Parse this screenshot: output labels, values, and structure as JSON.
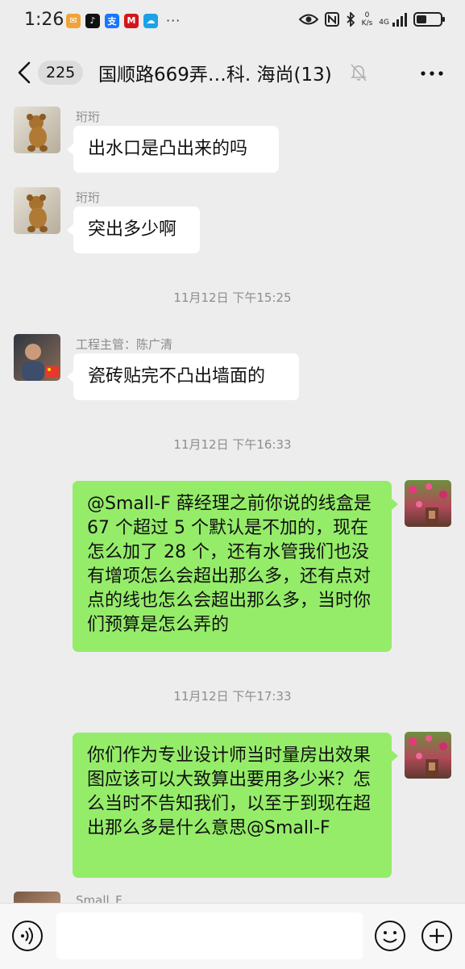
{
  "status_bar": {
    "time": "1:26",
    "speed_value": "0",
    "speed_unit": "K/s",
    "network": "4G"
  },
  "header": {
    "unread_count": "225",
    "title": "国顺路669弄…科. 海尚(13)"
  },
  "messages": [
    {
      "sender": "珩珩",
      "text": "出水口是凸出来的吗"
    },
    {
      "sender": "珩珩",
      "text": "突出多少啊"
    },
    {
      "timestamp": "11月12日 下午15:25"
    },
    {
      "sender": "工程主管：陈广清",
      "text": "瓷砖贴完不凸出墙面的"
    },
    {
      "timestamp": "11月12日 下午16:33"
    },
    {
      "text": "@Small-F  薛经理之前你说的线盒是 67 个超过 5 个默认是不加的，现在怎么加了 28 个，还有水管我们也没有增项怎么会超出那么多，还有点对点的线也怎么会超出那么多，当时你们预算是怎么弄的"
    },
    {
      "timestamp": "11月12日 下午17:33"
    },
    {
      "text": "你们作为专业设计师当时量房出效果图应该可以大致算出要用多少米？怎么当时不告知我们，以至于到现在超出那么多是什么意思@Small-F"
    },
    {
      "sender": "Small_F"
    }
  ],
  "colors": {
    "chat_background": "#ededed",
    "incoming_bubble": "#ffffff",
    "outgoing_bubble": "#95ec69"
  },
  "icons": {
    "back": "chevron-left-icon",
    "mute": "bell-off-icon",
    "more": "more-dots-icon",
    "voice": "voice-icon",
    "emoji": "emoji-icon",
    "plus": "plus-icon"
  }
}
